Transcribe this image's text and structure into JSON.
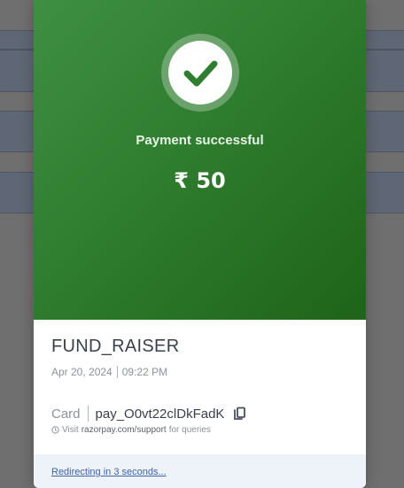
{
  "status": {
    "title": "Payment successful",
    "amount": "₹ 50"
  },
  "merchant": {
    "name": "FUND_RAISER"
  },
  "transaction": {
    "date": "Apr 20, 2024",
    "time": "09:22 PM",
    "method": "Card",
    "payment_id": "pay_O0vt22clDkFadK"
  },
  "support": {
    "prefix": "Visit",
    "link": "razorpay.com/support",
    "suffix": "for queries"
  },
  "footer": {
    "redirect_text": "Redirecting in 3 seconds..."
  },
  "icons": {
    "success": "check-icon",
    "copy": "copy-icon",
    "support": "clock-icon"
  },
  "colors": {
    "success_green": "#2f7d2f",
    "link_blue": "#3e63a8"
  }
}
